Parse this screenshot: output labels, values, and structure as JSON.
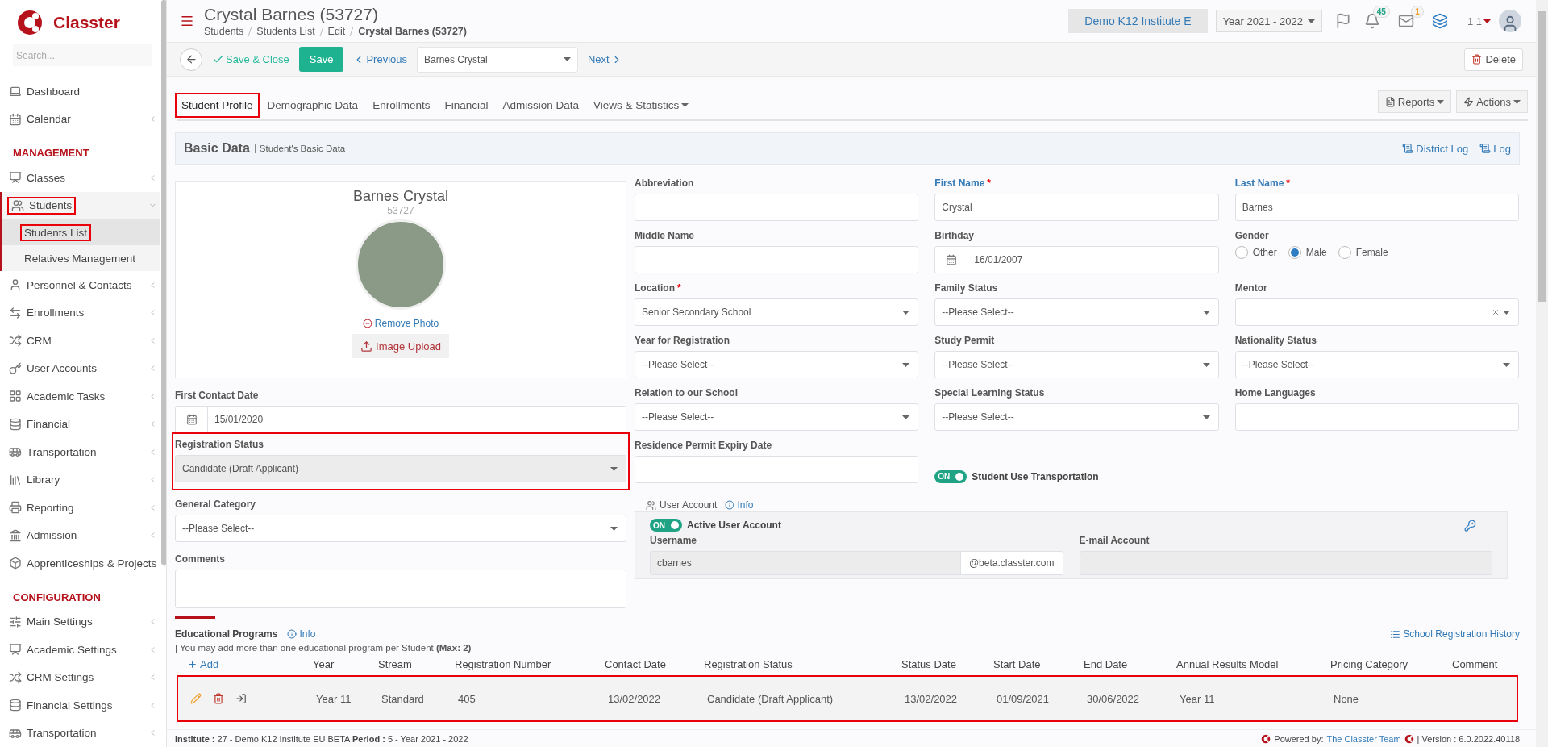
{
  "sidebar": {
    "logo": "Classter",
    "search": {
      "placeholder": "Search..."
    },
    "sections": [
      {
        "items": [
          {
            "label": "Dashboard",
            "highlighted": false
          },
          {
            "label": "Calendar",
            "expanded": false,
            "highlighted": false
          }
        ]
      },
      {
        "heading": "MANAGEMENT",
        "items": [
          {
            "label": "Classes",
            "expanded": false,
            "highlighted": false
          },
          {
            "label": "Students",
            "expanded": true,
            "highlighted": true,
            "children": [
              {
                "label": "Students List",
                "selected": true,
                "highlighted": true
              },
              {
                "label": "Relatives Management",
                "selected": false,
                "highlighted": false
              }
            ]
          },
          {
            "label": "Personnel & Contacts",
            "expanded": false,
            "highlighted": false
          },
          {
            "label": "Enrollments",
            "expanded": false,
            "highlighted": false
          },
          {
            "label": "CRM",
            "expanded": false,
            "highlighted": false
          },
          {
            "label": "User Accounts",
            "expanded": false,
            "highlighted": false
          },
          {
            "label": "Academic Tasks",
            "expanded": false,
            "highlighted": false
          },
          {
            "label": "Financial",
            "expanded": false,
            "highlighted": false
          },
          {
            "label": "Transportation",
            "expanded": false,
            "highlighted": false
          },
          {
            "label": "Library",
            "expanded": false,
            "highlighted": false
          },
          {
            "label": "Reporting",
            "expanded": false,
            "highlighted": false
          },
          {
            "label": "Admission",
            "expanded": false,
            "highlighted": false
          },
          {
            "label": "Apprenticeships & Projects",
            "expanded": false,
            "highlighted": false
          }
        ]
      },
      {
        "heading": "CONFIGURATION",
        "items": [
          {
            "label": "Main Settings",
            "expanded": false,
            "highlighted": false
          },
          {
            "label": "Academic Settings",
            "expanded": false,
            "highlighted": false
          },
          {
            "label": "CRM Settings",
            "expanded": false,
            "highlighted": false
          },
          {
            "label": "Financial Settings",
            "expanded": false,
            "highlighted": false
          },
          {
            "label": "Transportation",
            "expanded": false,
            "highlighted": false
          }
        ]
      }
    ]
  },
  "header": {
    "title": "Crystal Barnes (53727)",
    "breadcrumb": [
      "Students",
      "Students List",
      "Edit",
      "Crystal Barnes (53727)"
    ],
    "institute": "Demo K12 Institute E",
    "year": "Year 2021 - 2022",
    "notifications": "45",
    "messages": "1",
    "user": "1 1"
  },
  "toolbar": {
    "save_close": "Save & Close",
    "save": "Save",
    "previous": "Previous",
    "record": "Barnes Crystal",
    "next": "Next",
    "delete": "Delete"
  },
  "tabs": [
    {
      "label": "Student Profile",
      "kind": "tab",
      "selected": true,
      "highlighted": true
    },
    {
      "label": "Demographic Data",
      "kind": "tab",
      "selected": false,
      "highlighted": false
    },
    {
      "label": "Enrollments",
      "kind": "tab",
      "selected": false,
      "highlighted": false
    },
    {
      "label": "Financial",
      "kind": "tab",
      "selected": false,
      "highlighted": false
    },
    {
      "label": "Admission Data",
      "kind": "tab",
      "selected": false,
      "highlighted": false
    },
    {
      "label": "Views & Statistics",
      "kind": "dropdown",
      "selected": false,
      "highlighted": false
    }
  ],
  "tab_actions": [
    "Reports",
    "Actions"
  ],
  "section": {
    "title": "Basic Data",
    "subtitle": "Student's Basic Data",
    "links": [
      "District Log",
      "Log"
    ]
  },
  "profile": {
    "name": "Barnes Crystal",
    "id": "53727",
    "remove_photo": "Remove Photo",
    "upload": "Image Upload"
  },
  "left_fields": [
    {
      "label": "First Contact Date",
      "kind": "date",
      "value": "15/01/2020"
    },
    {
      "label": "Registration Status",
      "kind": "select",
      "value": "Candidate (Draft Applicant)",
      "disabled": true,
      "highlighted": true
    },
    {
      "label": "General Category",
      "kind": "select",
      "value": "--Please Select--",
      "disabled": false
    },
    {
      "label": "Comments",
      "kind": "textarea"
    }
  ],
  "fields": [
    {
      "label": "Abbreviation",
      "kind": "text"
    },
    {
      "label": "First Name",
      "required_mark": "*",
      "kind": "text",
      "value": "Crystal",
      "primary": true
    },
    {
      "label": "Last Name",
      "required_mark": "*",
      "kind": "text",
      "value": "Barnes",
      "primary": true
    },
    {
      "label": "Middle Name",
      "kind": "text"
    },
    {
      "label": "Birthday",
      "kind": "date",
      "value": "16/01/2007"
    },
    {
      "label": "Gender",
      "kind": "radio",
      "options": [
        {
          "label": "Other",
          "selected": false
        },
        {
          "label": "Male",
          "selected": true
        },
        {
          "label": "Female",
          "selected": false
        }
      ]
    },
    {
      "label": "Location",
      "required_mark": "*",
      "kind": "select",
      "value": "Senior Secondary School"
    },
    {
      "label": "Family Status",
      "kind": "select",
      "value": "--Please Select--"
    },
    {
      "label": "Mentor",
      "kind": "clearable"
    },
    {
      "label": "Year for Registration",
      "kind": "select",
      "value": "--Please Select--"
    },
    {
      "label": "Study Permit",
      "kind": "select",
      "value": "--Please Select--"
    },
    {
      "label": "Nationality Status",
      "kind": "select",
      "value": "--Please Select--"
    },
    {
      "label": "Relation to our School",
      "kind": "select",
      "value": "--Please Select--"
    },
    {
      "label": "Special Learning Status",
      "kind": "select",
      "value": "--Please Select--"
    },
    {
      "label": "Home Languages",
      "kind": "text"
    },
    {
      "label": "Residence Permit Expiry Date",
      "kind": "text"
    },
    {
      "label": "Student Use Transportation",
      "kind": "toggle",
      "on": true,
      "on_label": "ON"
    }
  ],
  "user_account": {
    "title": "User Account",
    "info": "Info",
    "toggle": {
      "label": "Active User Account",
      "on": true,
      "on_label": "ON"
    },
    "username": {
      "label": "Username",
      "value": "cbarnes",
      "suffix": "@beta.classter.com",
      "disabled": true
    },
    "email": {
      "label": "E-mail Account",
      "disabled": true
    }
  },
  "programs": {
    "title": "Educational Programs",
    "info": "Info",
    "note": "| You may add more than one educational program per Student **(Max: 2)**",
    "history": "School Registration History",
    "add": "Add",
    "columns": [
      "Year",
      "Stream",
      "Registration Number",
      "Contact Date",
      "Registration Status",
      "Status Date",
      "Start Date",
      "End Date",
      "Annual Results Model",
      "Pricing Category",
      "Comment"
    ],
    "rows": [
      {
        "highlighted": true,
        "cells": [
          "Year 11",
          "Standard",
          "405",
          "13/02/2022",
          "Candidate (Draft Applicant)",
          "13/02/2022",
          "01/09/2021",
          "30/06/2022",
          "Year 11",
          "None"
        ]
      }
    ]
  },
  "footer": {
    "left": "**Institute :** 27 - Demo K12 Institute EU BETA **Period :** 5 - Year 2021 - 2022",
    "powered": "Powered by:",
    "team": "The Classter Team",
    "version": "| Version : 6.0.2022.40118"
  }
}
